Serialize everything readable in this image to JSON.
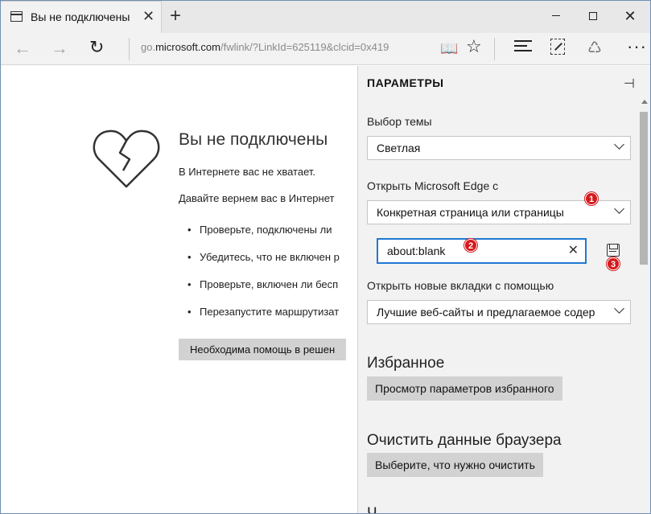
{
  "tab": {
    "title": "Вы не подключены",
    "close_glyph": "✕"
  },
  "new_tab_glyph": "+",
  "window_controls": {
    "close_glyph": "✕"
  },
  "toolbar": {
    "back_glyph": "←",
    "forward_glyph": "→",
    "refresh_glyph": "↻",
    "address_prefix": "go.",
    "address_domain": "microsoft.com",
    "address_path": "/fwlink/?LinkId=625119&clcid=0x419",
    "reading_glyph": "📖",
    "favorite_glyph": "☆",
    "share_glyph": "♺",
    "more_glyph": "···"
  },
  "page": {
    "title": "Вы не подключены",
    "line1": "В Интернете вас не хватает.",
    "line2": "Давайте вернем вас в Интернет",
    "bullets": [
      "Проверьте, подключены ли",
      "Убедитесь, что не включен р",
      "Проверьте, включен ли бесп",
      "Перезапустите маршрутизат"
    ],
    "help_button": "Необходима помощь в решен"
  },
  "settings": {
    "header": "ПАРАМЕТРЫ",
    "pin_glyph": "⊣",
    "theme_label": "Выбор темы",
    "theme_value": "Светлая",
    "open_with_label": "Открыть Microsoft Edge с",
    "open_with_value": "Конкретная страница или страницы",
    "url_value": "about:blank",
    "clear_glyph": "✕",
    "new_tabs_label": "Открыть новые вкладки с помощью",
    "new_tabs_value": "Лучшие веб-сайты и предлагаемое содер",
    "favorites_heading": "Избранное",
    "favorites_button": "Просмотр параметров избранного",
    "clear_heading": "Очистить данные браузера",
    "clear_button": "Выберите, что нужно очистить",
    "next_heading_partial": "Ч"
  },
  "annotations": {
    "badge1": "1",
    "badge2": "2",
    "badge3": "3"
  },
  "colors": {
    "badge": "#d4191d",
    "input_focus": "#1f78d1",
    "panel_bg": "#f2f2f2",
    "window_border": "#6f8fb4"
  }
}
